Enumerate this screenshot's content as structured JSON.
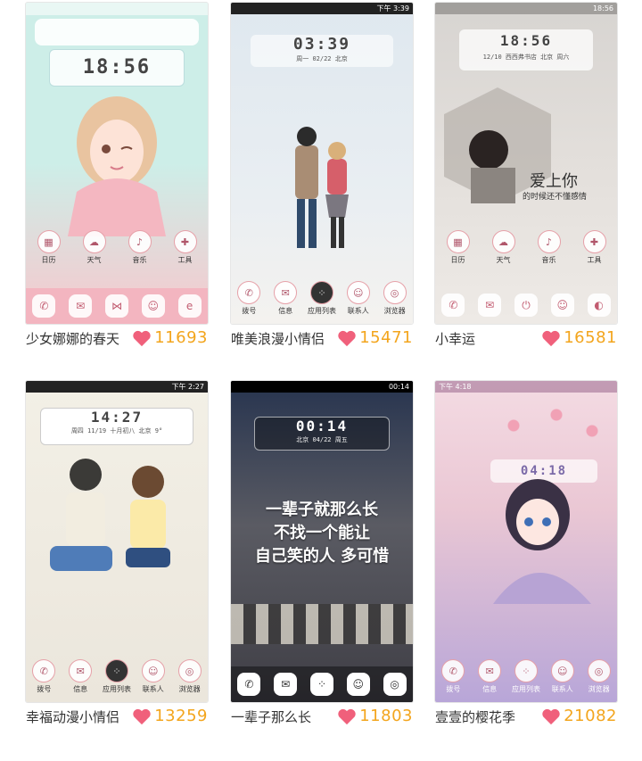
{
  "themes": [
    {
      "title": "少女娜娜的春天",
      "likes": "11693",
      "clock": "18:56",
      "clock_meta": "",
      "apps": [
        "日历",
        "天气",
        "音乐",
        "工具"
      ],
      "colors": {
        "bg_top": "#cdeee8",
        "bg_bottom": "#f7c7cc",
        "accent": "#e66f86"
      }
    },
    {
      "title": "唯美浪漫小情侣",
      "likes": "15471",
      "clock": "03:39",
      "status_time": "下午 3:39",
      "clock_meta": "周一  02/22  北京",
      "apps": [
        "拨号",
        "信息",
        "应用列表",
        "联系人",
        "浏览器"
      ],
      "colors": {
        "bg_top": "#dde7ef",
        "bg_bottom": "#f1f1ee",
        "accent": "#c98c96"
      }
    },
    {
      "title": "小幸运",
      "likes": "16581",
      "clock": "18:56",
      "status_time": "18:56",
      "clock_meta": "12/10  西西弗书店  北京  周六",
      "quote": "爱上你",
      "quote2": "的时候还不懂感情",
      "apps": [
        "日历",
        "天气",
        "音乐",
        "工具"
      ],
      "colors": {
        "bg_top": "#d9d6d3",
        "bg_bottom": "#ece8e4",
        "accent": "#d06a84"
      }
    },
    {
      "title": "幸福动漫小情侣",
      "likes": "13259",
      "clock": "14:27",
      "status_time": "下午 2:27",
      "clock_meta": "周四  11/19  十月初八  北京  9°",
      "apps": [
        "拨号",
        "信息",
        "应用列表",
        "联系人",
        "浏览器"
      ],
      "colors": {
        "bg_top": "#f2efe4",
        "bg_bottom": "#e8e2d8",
        "accent": "#d77886"
      }
    },
    {
      "title": "一辈子那么长",
      "likes": "11803",
      "clock": "00:14",
      "status_time": "00:14",
      "clock_meta": "北京  04/22  周五",
      "quote": "一辈子就那么长",
      "quote2": "不找一个能让",
      "quote3": "自己笑的人 多可惜",
      "colors": {
        "bg_top": "#2d3a57",
        "bg_bottom": "#4a4a52",
        "accent": "#ffffff"
      }
    },
    {
      "title": "壹壹的樱花季",
      "likes": "21082",
      "clock": "04:18",
      "status_time": "下午 4:18",
      "clock_meta": "",
      "apps": [
        "拨号",
        "信息",
        "应用列表",
        "联系人",
        "浏览器"
      ],
      "colors": {
        "bg_top": "#f6d9e1",
        "bg_bottom": "#b4a3d7",
        "accent": "#e77b98"
      }
    }
  ]
}
